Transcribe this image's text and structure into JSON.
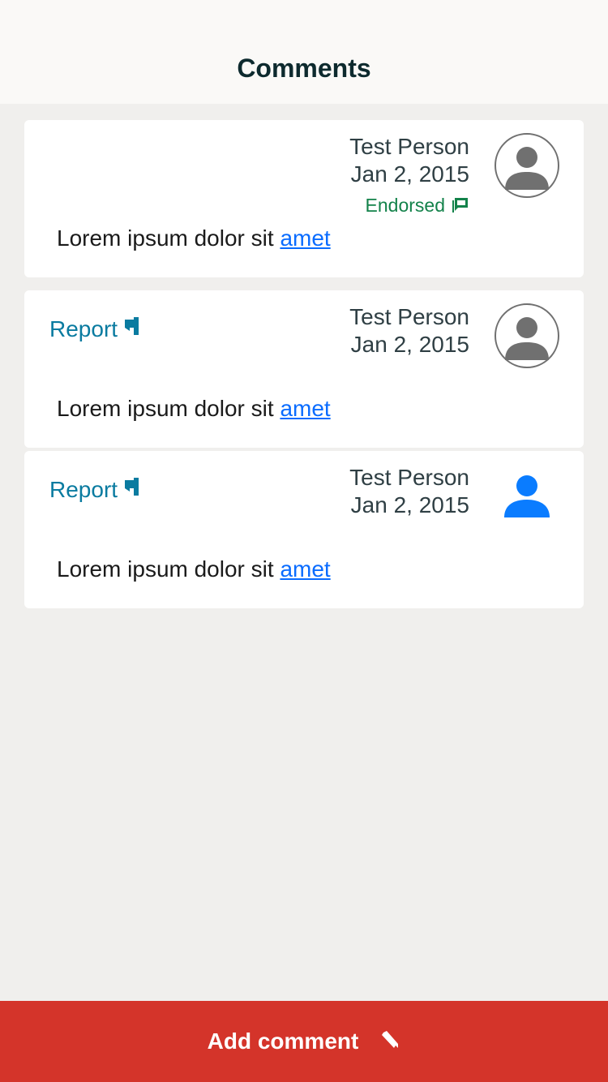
{
  "header": {
    "title": "Comments"
  },
  "comments": [
    {
      "author": "Test Person",
      "date": "Jan 2, 2015",
      "endorsed_label": "Endorsed",
      "text": "Lorem ipsum dolor sit ",
      "link_text": "amet",
      "avatar_icon": "user-circle-outline-icon"
    },
    {
      "author": "Test Person",
      "date": "Jan 2, 2015",
      "report_label": "Report",
      "text": "Lorem ipsum dolor sit ",
      "link_text": "amet",
      "avatar_icon": "user-circle-outline-icon"
    },
    {
      "author": "Test Person",
      "date": "Jan 2, 2015",
      "report_label": "Report",
      "text": "Lorem ipsum dolor sit ",
      "link_text": "amet",
      "avatar_icon": "user-solid-icon"
    }
  ],
  "footer": {
    "add_label": "Add comment",
    "add_icon": "pencil-icon"
  },
  "colors": {
    "header_bg": "#faf9f7",
    "page_bg": "#f0efed",
    "endorsed": "#13824a",
    "report": "#0a7ba0",
    "link": "#0a6cff",
    "add_bar": "#d4342a",
    "avatar_grey": "#707070",
    "avatar_blue": "#0a7cff"
  }
}
